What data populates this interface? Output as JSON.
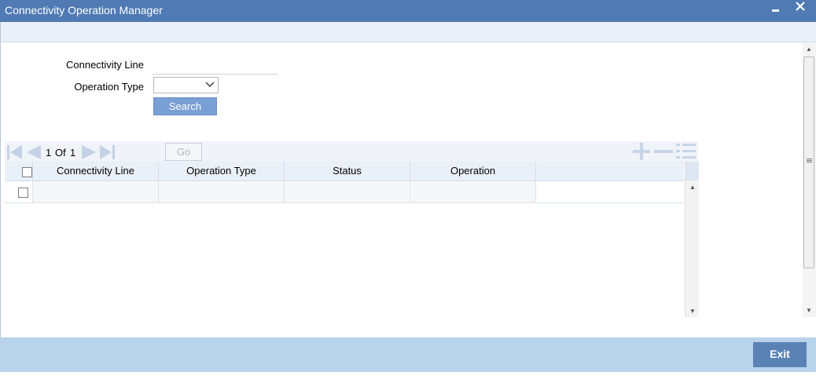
{
  "window": {
    "title": "Connectivity Operation Manager",
    "minimize_icon": "minimize-icon",
    "close_icon": "close-icon"
  },
  "form": {
    "connectivity_line_label": "Connectivity Line",
    "connectivity_line_value": "",
    "operation_type_label": "Operation Type",
    "operation_type_value": "",
    "search_label": "Search"
  },
  "pager": {
    "current": "1",
    "of_label": "Of",
    "total": "1",
    "go_input_value": "",
    "go_label": "Go"
  },
  "grid": {
    "columns": [
      "Connectivity Line",
      "Operation Type",
      "Status",
      "Operation"
    ],
    "rows": [
      {
        "connectivity_line": "",
        "operation_type": "",
        "status": "",
        "operation": ""
      }
    ]
  },
  "footer": {
    "exit_label": "Exit"
  }
}
